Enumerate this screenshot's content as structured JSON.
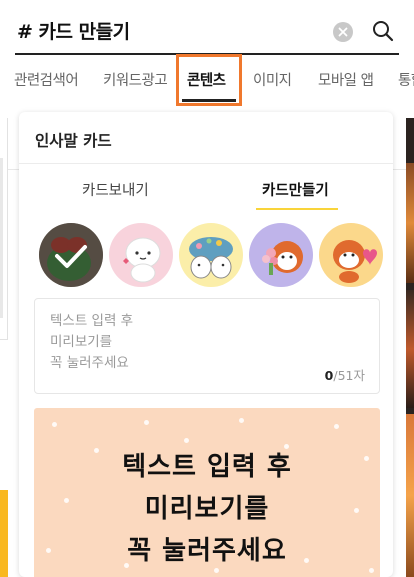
{
  "search": {
    "query": "# 카드 만들기",
    "clear_icon": "clear-icon",
    "search_icon": "search-icon"
  },
  "tabs": [
    {
      "label": "관련검색어"
    },
    {
      "label": "키워드광고"
    },
    {
      "label": "콘텐츠"
    },
    {
      "label": "이미지"
    },
    {
      "label": "모바일 앱"
    },
    {
      "label": "통합"
    }
  ],
  "active_tab": "콘텐츠",
  "highlight_color": "#f0782d",
  "card": {
    "title": "인사말 카드",
    "sub_tabs": [
      {
        "label": "카드보내기"
      },
      {
        "label": "카드만들기"
      }
    ],
    "active_sub_tab": "카드만들기",
    "accent_color": "#f9d43a",
    "stickers": [
      {
        "name": "green-character-sticker",
        "selected": true
      },
      {
        "name": "white-bunny-sticker",
        "selected": false
      },
      {
        "name": "animal-group-sticker",
        "selected": false
      },
      {
        "name": "red-panda-bouquet-sticker",
        "selected": false
      },
      {
        "name": "red-panda-heart-sticker",
        "selected": false
      }
    ],
    "textbox": {
      "placeholder": "텍스트 입력 후\n미리보기를\n꼭 눌러주세요",
      "count": "0",
      "max": "/51자"
    },
    "preview": {
      "text": "텍스트 입력 후\n미리보기를\n꼭 눌러주세요",
      "background": "#fbd9bf"
    }
  }
}
